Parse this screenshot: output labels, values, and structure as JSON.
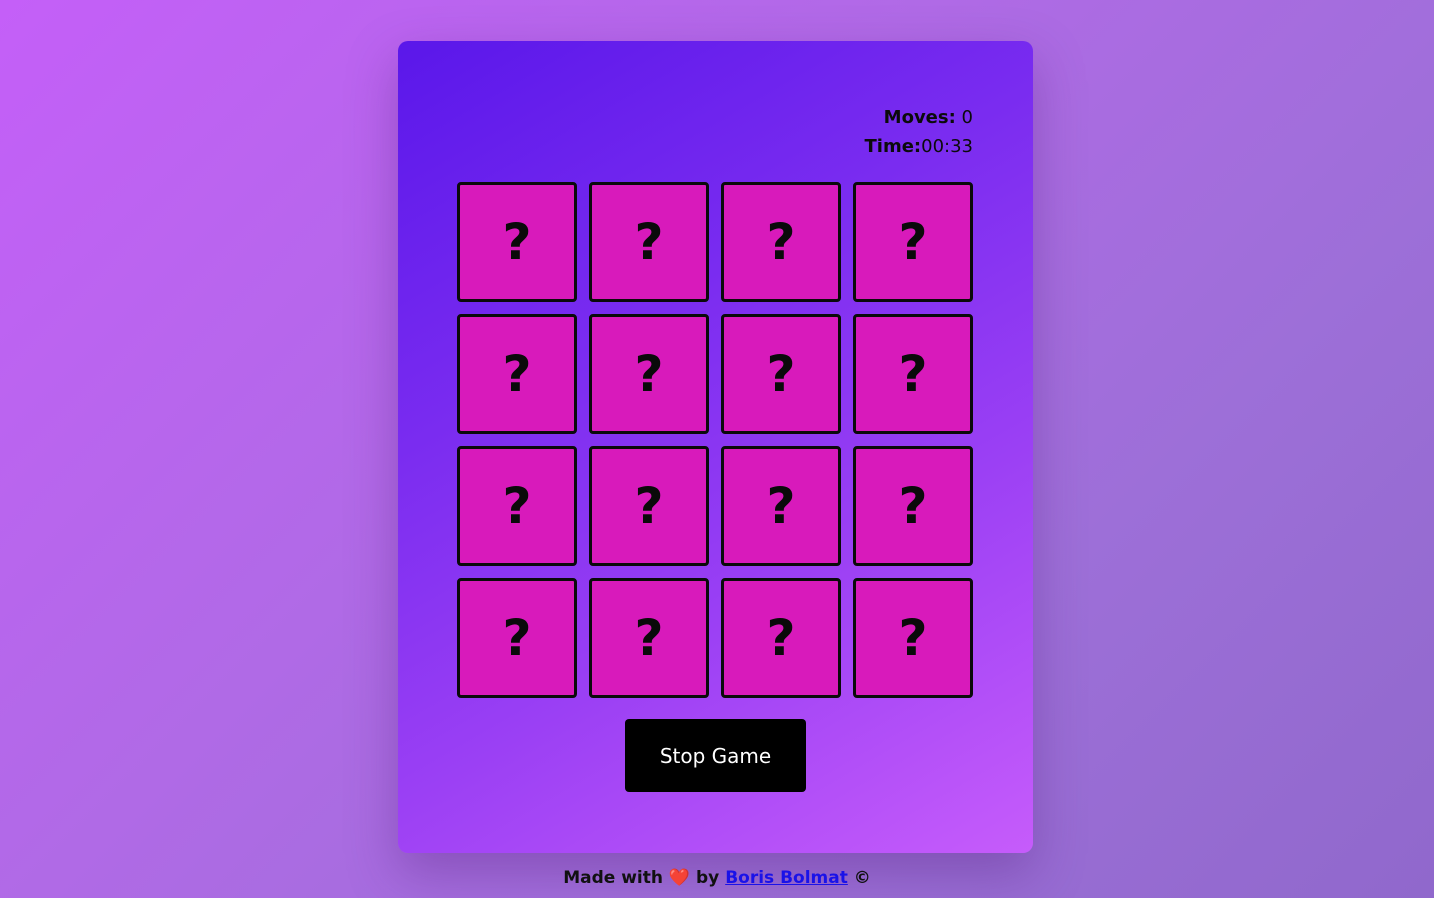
{
  "stats": {
    "moves_label": "Moves:",
    "moves_value": "0",
    "time_label": "Time:",
    "time_value": "00:33"
  },
  "board": {
    "rows": 4,
    "columns": 4,
    "cards": [
      "?",
      "?",
      "?",
      "?",
      "?",
      "?",
      "?",
      "?",
      "?",
      "?",
      "?",
      "?",
      "?",
      "?",
      "?",
      "?"
    ]
  },
  "controls": {
    "stop_label": "Stop Game"
  },
  "footer": {
    "made_with": "Made with",
    "heart": "❤️",
    "by": "by",
    "author": "Boris Bolmat",
    "copyright": "©"
  },
  "colors": {
    "card_face": "#d81abb",
    "card_border": "#0a0a0a",
    "button_bg": "#000000",
    "link": "#1a12e8"
  }
}
